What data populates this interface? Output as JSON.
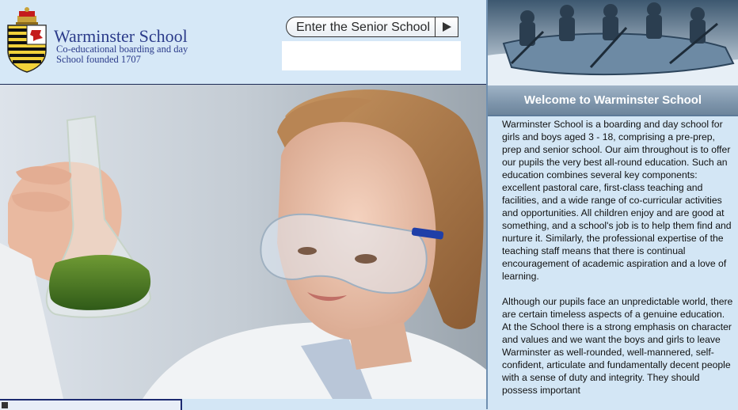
{
  "header": {
    "school_name": "Warminster School",
    "tagline_line1": "Co-educational boarding and day",
    "tagline_line2": "School founded 1707",
    "senior_button": "Enter the Senior School"
  },
  "welcome": {
    "title": "Welcome to Warminster School",
    "paragraphs": [
      "Warminster School is a boarding and day school for girls and boys aged 3 - 18, comprising a pre-prep, prep and senior school. Our aim throughout is to offer our pupils the very best all-round education. Such an education combines several key components: excellent pastoral care, first-class teaching and facilities, and a wide range of co-curricular activities and opportunities. All children enjoy and are good at something, and a school's job is to help them find and nurture it. Similarly, the professional expertise of the teaching staff means that there is continual encouragement of academic aspiration and a love of learning.",
      "Although our pupils face an unpredictable world, there are certain timeless aspects of a genuine education. At the School there is a strong emphasis on character and values and we want the boys and girls to leave Warminster as well-rounded, well-mannered, self-confident, articulate and fundamentally decent people with a sense of duty and integrity. They should possess important"
    ]
  },
  "colors": {
    "brand_blue": "#2b3b8a",
    "header_bg": "#d6e8f7",
    "page_bg": "#d3e6f5",
    "welcome_bar": "#7e95ab"
  },
  "icons": [
    "school-crest",
    "play-arrow-icon"
  ]
}
